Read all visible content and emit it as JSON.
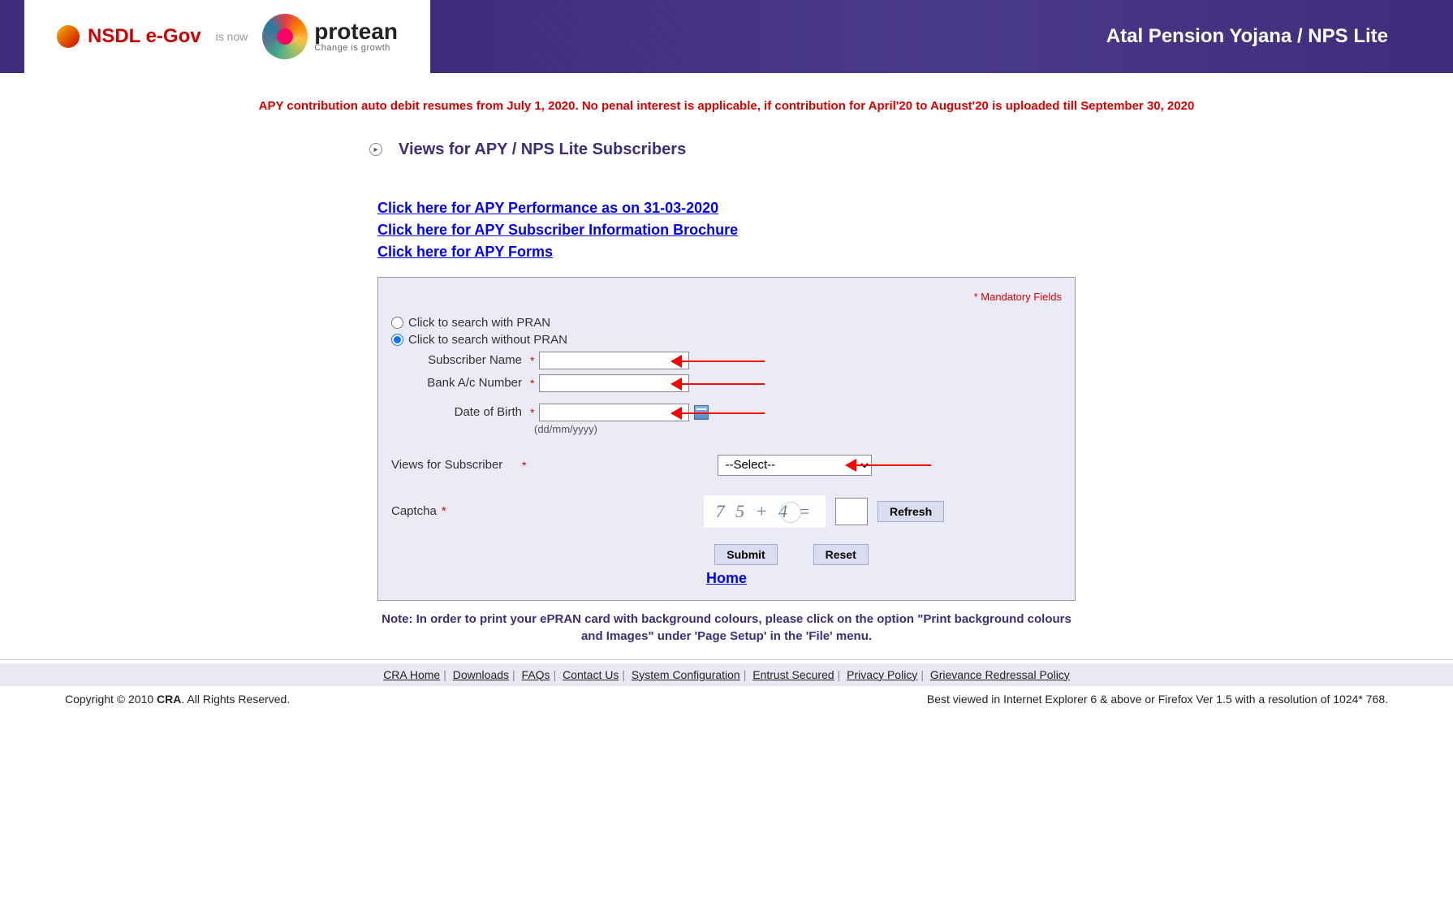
{
  "header": {
    "nsdl": "NSDL e-Gov",
    "isnow": "is now",
    "protean": "protean",
    "protean_sub": "Change is growth",
    "banner": "Atal Pension Yojana / NPS Lite"
  },
  "notice": "APY contribution auto debit resumes from July 1, 2020. No penal interest is applicable, if contribution for April'20 to August'20 is uploaded till September 30, 2020",
  "section_title": "Views for APY / NPS Lite Subscribers",
  "links": {
    "perf": "Click here for APY Performance as on 31-03-2020",
    "brochure": "Click here for APY Subscriber Information Brochure",
    "forms": "Click here for APY Forms"
  },
  "form": {
    "mandatory": "* Mandatory Fields",
    "radio_with": "Click to search with PRAN",
    "radio_without": "Click to search without PRAN",
    "subscriber_label": "Subscriber Name",
    "bank_label": "Bank A/c Number",
    "dob_label": "Date of Birth",
    "dob_hint": "(dd/mm/yyyy)",
    "views_label": "Views for Subscriber",
    "select_default": "--Select--",
    "captcha_label": "Captcha",
    "captcha_text": "7 5 + 4 =",
    "refresh": "Refresh",
    "submit": "Submit",
    "reset": "Reset",
    "home": "Home",
    "subscriber_value": "",
    "bank_value": "",
    "dob_value": "",
    "captcha_value": ""
  },
  "note": "Note: In order to print your ePRAN card with background colours, please click on the option \"Print background colours and Images\" under 'Page Setup' in the 'File' menu.",
  "footer": {
    "cra_home": "CRA Home",
    "downloads": "Downloads",
    "faqs": "FAQs",
    "contact": "Contact Us",
    "sysconfig": "System Configuration",
    "entrust": "Entrust Secured",
    "privacy": "Privacy Policy",
    "grievance": "Grievance Redressal Policy",
    "copyright_pre": "Copyright © 2010 ",
    "copyright_bold": "CRA",
    "copyright_post": ". All Rights Reserved.",
    "bestviewed": "Best viewed in Internet Explorer 6 & above or Firefox Ver 1.5 with a resolution of 1024* 768."
  }
}
